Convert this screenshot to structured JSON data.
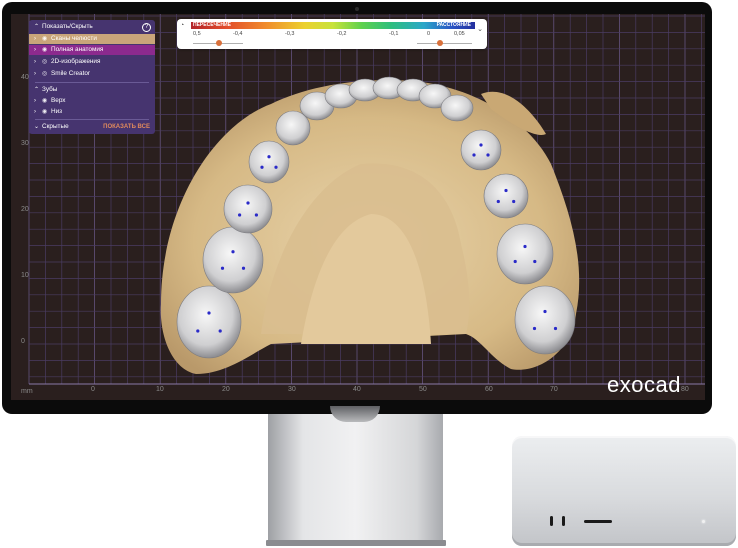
{
  "app": {
    "logo": "exocad",
    "units": "mm"
  },
  "visibility_panel": {
    "header": "Показать/Скрыть",
    "items": [
      {
        "label": "Сканы челюсти",
        "bg": "#c9a57a"
      },
      {
        "label": "Полная анатомия",
        "bg": "#8c2a8e"
      },
      {
        "label": "2D-изображения",
        "bg": ""
      },
      {
        "label": "Smile Creator",
        "bg": ""
      }
    ],
    "teeth_header": "Зубы",
    "teeth_items": [
      "Верх",
      "Низ"
    ],
    "hidden_label": "Скрытые",
    "show_all": "ПОКАЗАТЬ ВСЕ"
  },
  "deviation_bar": {
    "left_label": "ПЕРЕСЕЧЕНИЕ",
    "right_label": "РАССТОЯНИЕ",
    "ticks": [
      "0,5",
      "-0,4",
      "-0,3",
      "-0,2",
      "-0,1",
      "0",
      "0,05"
    ],
    "left_slider": 0.52,
    "right_slider": 0.42
  },
  "axes": {
    "x_ticks": [
      "0",
      "10",
      "20",
      "30",
      "40",
      "50",
      "60",
      "70",
      "80"
    ],
    "y_ticks": [
      "40",
      "30",
      "20",
      "10",
      "0"
    ]
  },
  "colors": {
    "screen_bg": "#2a1f1e",
    "grid": "#5b4a78",
    "panel_bg": "#46346f",
    "gum": "#dcc092",
    "tooth": "#e6e6e6"
  }
}
